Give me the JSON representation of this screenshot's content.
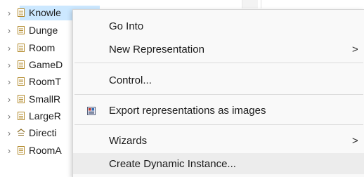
{
  "tree": {
    "items": [
      {
        "label": "Knowle",
        "icon": "representation-icon",
        "selected": true
      },
      {
        "label": "Dunge",
        "icon": "representation-icon"
      },
      {
        "label": "Room",
        "icon": "representation-icon"
      },
      {
        "label": "GameD",
        "icon": "representation-icon"
      },
      {
        "label": "RoomT",
        "icon": "representation-icon"
      },
      {
        "label": "SmallR",
        "icon": "representation-icon"
      },
      {
        "label": "LargeR",
        "icon": "representation-icon"
      },
      {
        "label": "Directi",
        "icon": "enumeration-icon"
      },
      {
        "label": "RoomA",
        "icon": "representation-icon"
      }
    ],
    "twisty": "›"
  },
  "context_menu": {
    "items": [
      {
        "label": "Go Into"
      },
      {
        "label": "New Representation",
        "submenu": true
      },
      {
        "label": "Control..."
      },
      {
        "label": "Export representations as images",
        "icon": "export-images-icon"
      },
      {
        "label": "Wizards",
        "submenu": true
      },
      {
        "label": "Create Dynamic Instance...",
        "hovered": true
      }
    ],
    "submenu_arrow": ">"
  },
  "colors": {
    "selection": "#cce8ff",
    "menu_background": "#f9f9f9",
    "menu_hover": "#ececec",
    "icon_tan": "#b38b2d"
  }
}
